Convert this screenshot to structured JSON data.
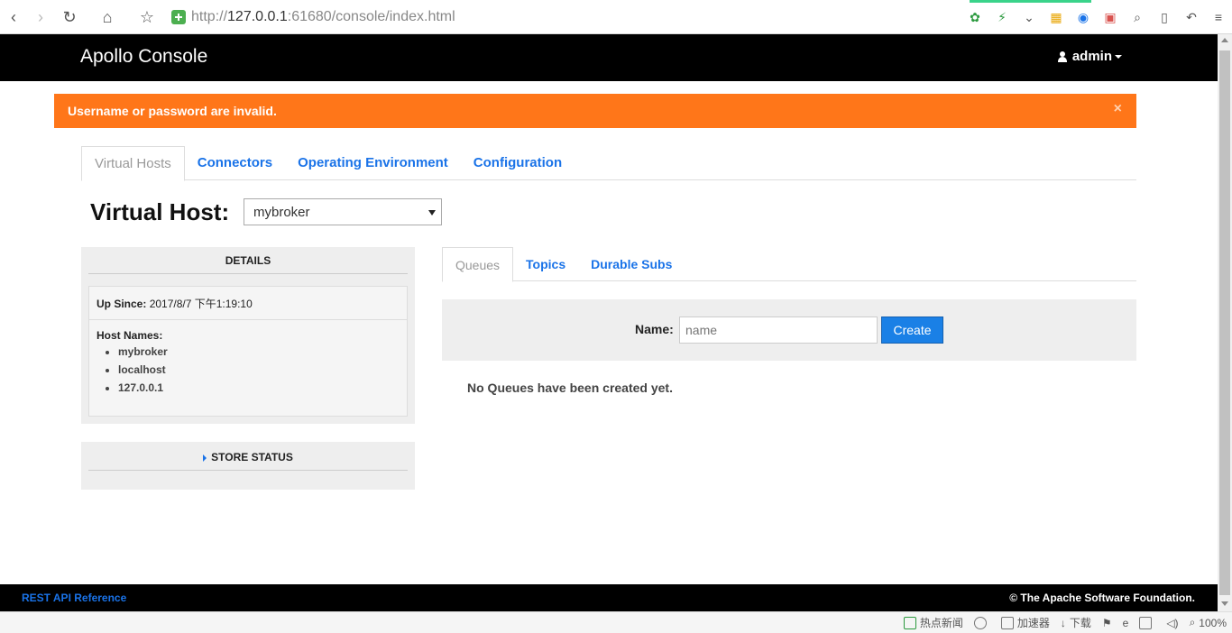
{
  "browser": {
    "url_prefix": "http://",
    "url_host": "127.0.0.1",
    "url_rest": ":61680/console/index.html"
  },
  "app": {
    "title": "Apollo Console",
    "user": "admin"
  },
  "alert": {
    "message": "Username or password are invalid.",
    "close": "×"
  },
  "tabs": [
    {
      "label": "Virtual Hosts"
    },
    {
      "label": "Connectors"
    },
    {
      "label": "Operating Environment"
    },
    {
      "label": "Configuration"
    }
  ],
  "virtual_host": {
    "label": "Virtual Host:",
    "selected": "mybroker"
  },
  "details": {
    "heading": "DETAILS",
    "up_since_label": "Up Since:",
    "up_since_value": "2017/8/7 下午1:19:10",
    "host_names_label": "Host Names:",
    "host_names": [
      "mybroker",
      "localhost",
      "127.0.0.1"
    ]
  },
  "store": {
    "heading": "STORE STATUS"
  },
  "subtabs": [
    {
      "label": "Queues"
    },
    {
      "label": "Topics"
    },
    {
      "label": "Durable Subs"
    }
  ],
  "create": {
    "name_label": "Name:",
    "placeholder": "name",
    "button": "Create"
  },
  "empty_message": "No Queues have been created yet.",
  "footer": {
    "link": "REST API Reference",
    "copyright": "© The Apache Software Foundation."
  },
  "statusbar": {
    "hot_news": "热点新闻",
    "accelerator": "加速器",
    "download": "下载",
    "zoom": "100%"
  },
  "colors": {
    "alert": "#ff7619",
    "link": "#1a73e8",
    "header": "#000000"
  }
}
